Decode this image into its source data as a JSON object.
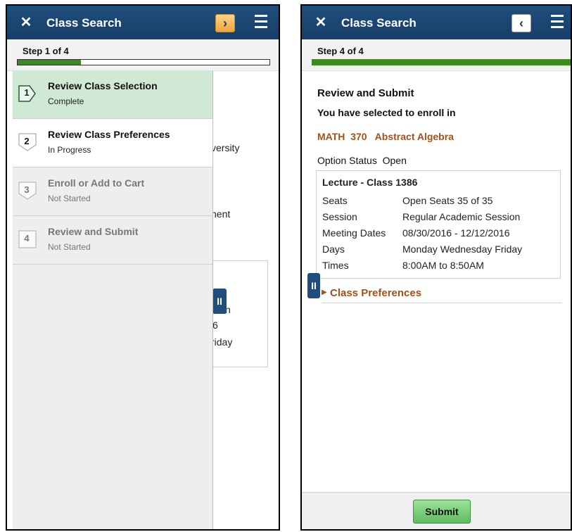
{
  "left": {
    "header": {
      "close_glyph": "✕",
      "title": "Class Search",
      "next_glyph": "›"
    },
    "step_label": "Step 1 of 4",
    "progress": 0.25,
    "background_text": [
      "versity",
      "nent",
      "n",
      "6",
      "riday"
    ],
    "steps": [
      {
        "number": "1",
        "title": "Review Class Selection",
        "status": "Complete",
        "state": "complete"
      },
      {
        "number": "2",
        "title": "Review Class Preferences",
        "status": "In Progress",
        "state": "active"
      },
      {
        "number": "3",
        "title": "Enroll or Add to Cart",
        "status": "Not Started",
        "state": "pending"
      },
      {
        "number": "4",
        "title": "Review and Submit",
        "status": "Not Started",
        "state": "pending"
      }
    ]
  },
  "right": {
    "header": {
      "close_glyph": "✕",
      "title": "Class Search",
      "prev_glyph": "‹"
    },
    "step_label": "Step 4 of 4",
    "progress": 1.0,
    "section_title": "Review and Submit",
    "subtitle": "You have selected to enroll in",
    "course": "MATH  370   Abstract Algebra",
    "option_status": "Option Status  Open",
    "class_card": {
      "title": "Lecture - Class 1386",
      "rows": [
        {
          "key": "Seats",
          "value": "Open Seats 35 of 35"
        },
        {
          "key": "Session",
          "value": "Regular Academic Session"
        },
        {
          "key": "Meeting Dates",
          "value": "08/30/2016 - 12/12/2016"
        },
        {
          "key": "Days",
          "value": "Monday Wednesday Friday"
        },
        {
          "key": "Times",
          "value": "8:00AM to 8:50AM"
        }
      ]
    },
    "preferences_link": "Class Preferences",
    "submit_label": "Submit"
  },
  "colors": {
    "header": "#1f4e7d",
    "progress": "#3c8a1e",
    "accent_text": "#a0521d",
    "complete_step": "#cfe9d4",
    "next_button": "#f8c36a"
  },
  "icons": {
    "close": "close-icon",
    "menu": "hamburger-menu-icon",
    "handle": "pause-handle-icon"
  }
}
